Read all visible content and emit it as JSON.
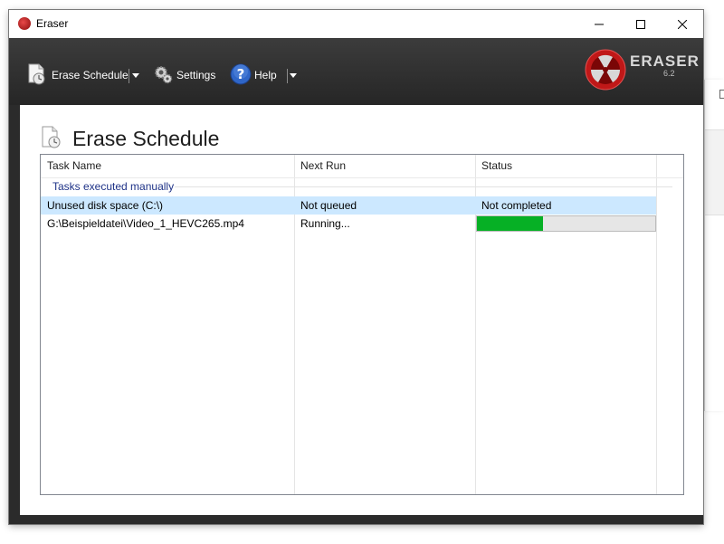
{
  "window": {
    "title": "Eraser"
  },
  "toolbar": {
    "erase_schedule_label": "Erase Schedule",
    "settings_label": "Settings",
    "help_label": "Help"
  },
  "logo": {
    "name": "ERASER",
    "version": "6.2"
  },
  "page": {
    "title": "Erase Schedule"
  },
  "table": {
    "columns": [
      "Task Name",
      "Next Run",
      "Status"
    ],
    "group": "Tasks executed manually",
    "rows": [
      {
        "task": "Unused disk space (C:\\)",
        "next_run": "Not queued",
        "status": "Not completed"
      },
      {
        "task": "G:\\Beispieldatei\\Video_1_HEVC265.mp4",
        "next_run": "Running...",
        "progress_fraction": 0.37
      }
    ]
  },
  "colors": {
    "accent_progress": "#06b025",
    "selection": "#cce8ff",
    "toolbar_bg": "#2b2b2b"
  }
}
